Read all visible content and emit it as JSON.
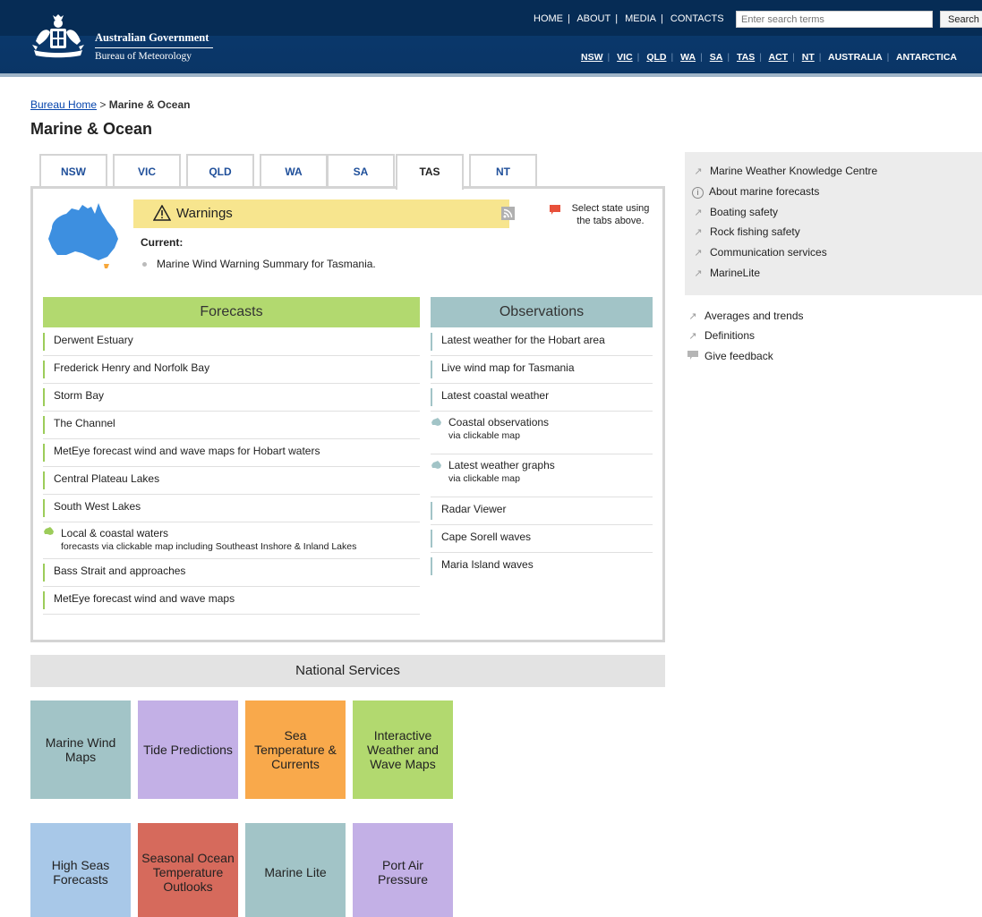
{
  "header": {
    "agency": "Australian Government",
    "bureau": "Bureau of Meteorology",
    "top_links": [
      "HOME",
      "ABOUT",
      "MEDIA",
      "CONTACTS"
    ],
    "search_placeholder": "Enter search terms",
    "search_button": "Search",
    "state_links": [
      "NSW",
      "VIC",
      "QLD",
      "WA",
      "SA",
      "TAS",
      "ACT",
      "NT",
      "AUSTRALIA",
      "ANTARCTICA"
    ]
  },
  "breadcrumb": {
    "home": "Bureau Home",
    "separator": ">",
    "current": "Marine & Ocean"
  },
  "page_title": "Marine & Ocean",
  "tabs": [
    "NSW",
    "VIC",
    "QLD",
    "WA",
    "SA",
    "TAS",
    "NT"
  ],
  "active_tab": "TAS",
  "warnings": {
    "title": "Warnings",
    "current_label": "Current:",
    "items": [
      "Marine Wind Warning Summary for Tasmania."
    ],
    "select_note": "Select state using the tabs above."
  },
  "forecasts": {
    "heading": "Forecasts",
    "items": [
      {
        "label": "Derwent Estuary"
      },
      {
        "label": "Frederick Henry and Norfolk Bay"
      },
      {
        "label": "Storm Bay"
      },
      {
        "label": "The Channel"
      },
      {
        "label": "MetEye forecast wind and wave maps for Hobart waters"
      },
      {
        "label": "Central Plateau Lakes"
      },
      {
        "label": "South West Lakes"
      },
      {
        "label": "Local & coastal waters",
        "sub": "forecasts via clickable map including Southeast Inshore & Inland Lakes"
      },
      {
        "label": "Bass Strait and approaches"
      },
      {
        "label": "MetEye forecast wind and wave maps"
      }
    ]
  },
  "observations": {
    "heading": "Observations",
    "items": [
      {
        "label": "Latest weather for the Hobart area"
      },
      {
        "label": "Live wind map for Tasmania"
      },
      {
        "label": "Latest coastal weather"
      },
      {
        "label": "Coastal observations",
        "sub": "via clickable map"
      },
      {
        "label": "Latest weather graphs",
        "sub": "via clickable map"
      },
      {
        "label": "Radar Viewer"
      },
      {
        "label": "Cape Sorell waves"
      },
      {
        "label": "Maria Island waves"
      }
    ]
  },
  "national_services": {
    "heading": "National Services",
    "tiles": [
      {
        "label": "Marine Wind Maps",
        "color": "#a2c4c7"
      },
      {
        "label": "Tide Predictions",
        "color": "#c3b0e6"
      },
      {
        "label": "Sea Temperature & Currents",
        "color": "#f9a94b"
      },
      {
        "label": "Interactive Weather and Wave Maps",
        "color": "#b2d96f"
      },
      {
        "label": "High Seas Forecasts",
        "color": "#a8c8e8"
      },
      {
        "label": "Seasonal Ocean Temperature Outlooks",
        "color": "#d66a5c"
      },
      {
        "label": "Marine Lite",
        "color": "#a2c4c7"
      },
      {
        "label": "Port Air Pressure",
        "color": "#c3b0e6"
      }
    ]
  },
  "sidebar": {
    "box_links": [
      {
        "label": "Marine Weather Knowledge Centre",
        "icon": "arrow-icon"
      },
      {
        "label": "About marine forecasts",
        "icon": "info-icon"
      },
      {
        "label": "Boating safety",
        "icon": "arrow-icon"
      },
      {
        "label": "Rock fishing safety",
        "icon": "arrow-icon"
      },
      {
        "label": "Communication services",
        "icon": "arrow-icon"
      },
      {
        "label": "MarineLite",
        "icon": "arrow-icon"
      }
    ],
    "links": [
      {
        "label": "Averages and trends",
        "icon": "arrow-icon"
      },
      {
        "label": "Definitions",
        "icon": "arrow-icon"
      },
      {
        "label": "Give feedback",
        "icon": "feedback-icon"
      }
    ]
  },
  "colors": {
    "header_blue": "#0a3566",
    "forecasts_green": "#b2d96f",
    "observations_teal": "#a2c4c7",
    "warning_yellow": "#f7e58e"
  }
}
